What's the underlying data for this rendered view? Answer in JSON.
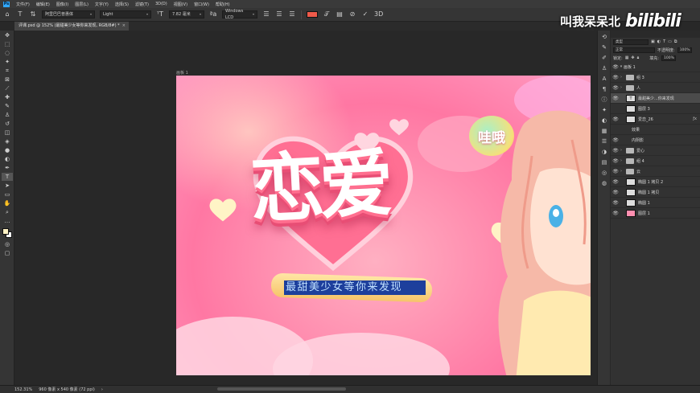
{
  "app": {
    "logo": "Ps"
  },
  "menu": [
    "文件(F)",
    "编辑(E)",
    "图像(I)",
    "图层(L)",
    "文字(Y)",
    "选择(S)",
    "滤镜(T)",
    "3D(D)",
    "视图(V)",
    "窗口(W)",
    "帮助(H)"
  ],
  "options": {
    "font_family": "阿里巴巴普惠体",
    "font_style": "Light",
    "font_size": "7.82 毫米",
    "antialias": "Windows LCD",
    "text_color": "#ef5a4a"
  },
  "document": {
    "tab_label": "评课.psd @ 152% (最甜美少女等你来发现, RGB/8#) *",
    "close": "×"
  },
  "artboard": {
    "label": "画板 1"
  },
  "canvas": {
    "bubble_text": "哇哦",
    "title_text": "恋爱",
    "subtitle_text": "最甜美少女等你来发现"
  },
  "status": {
    "zoom": "152.31%",
    "doc_size": "960 像素 x 540 像素 (72 ppi)"
  },
  "layers_panel": {
    "search_placeholder": "类型",
    "blend_mode": "正常",
    "opacity_label": "不透明度:",
    "opacity_value": "100%",
    "lock_label": "锁定:",
    "fill_label": "填充:",
    "fill_value": "100%",
    "layers": [
      {
        "name": "画板 1",
        "kind": "artboard",
        "selected": false,
        "fx": false
      },
      {
        "name": "组 3",
        "kind": "group",
        "selected": false,
        "fx": false
      },
      {
        "name": "人",
        "kind": "group",
        "selected": false,
        "fx": false
      },
      {
        "name": "最甜美少...你来发现",
        "kind": "text",
        "selected": true,
        "fx": false
      },
      {
        "name": "图层 3",
        "kind": "layer",
        "selected": false,
        "fx": false
      },
      {
        "name": "爱恋_26",
        "kind": "layer",
        "selected": false,
        "fx": true
      },
      {
        "name": "效果",
        "kind": "effect",
        "selected": false,
        "fx": false
      },
      {
        "name": "内阴影",
        "kind": "effect",
        "selected": false,
        "fx": false
      },
      {
        "name": "爱心",
        "kind": "group",
        "selected": false,
        "fx": false
      },
      {
        "name": "组 4",
        "kind": "group",
        "selected": false,
        "fx": false
      },
      {
        "name": "云",
        "kind": "group",
        "selected": false,
        "fx": false
      },
      {
        "name": "椭圆 1 拷贝 2",
        "kind": "layer",
        "selected": false,
        "fx": false
      },
      {
        "name": "椭圆 1 拷贝",
        "kind": "layer",
        "selected": false,
        "fx": false
      },
      {
        "name": "椭圆 1",
        "kind": "layer",
        "selected": false,
        "fx": false
      },
      {
        "name": "图层 1",
        "kind": "layer",
        "selected": false,
        "fx": false
      }
    ]
  },
  "watermark": {
    "text": "叫我呆呆北",
    "logo": "bilibili"
  }
}
